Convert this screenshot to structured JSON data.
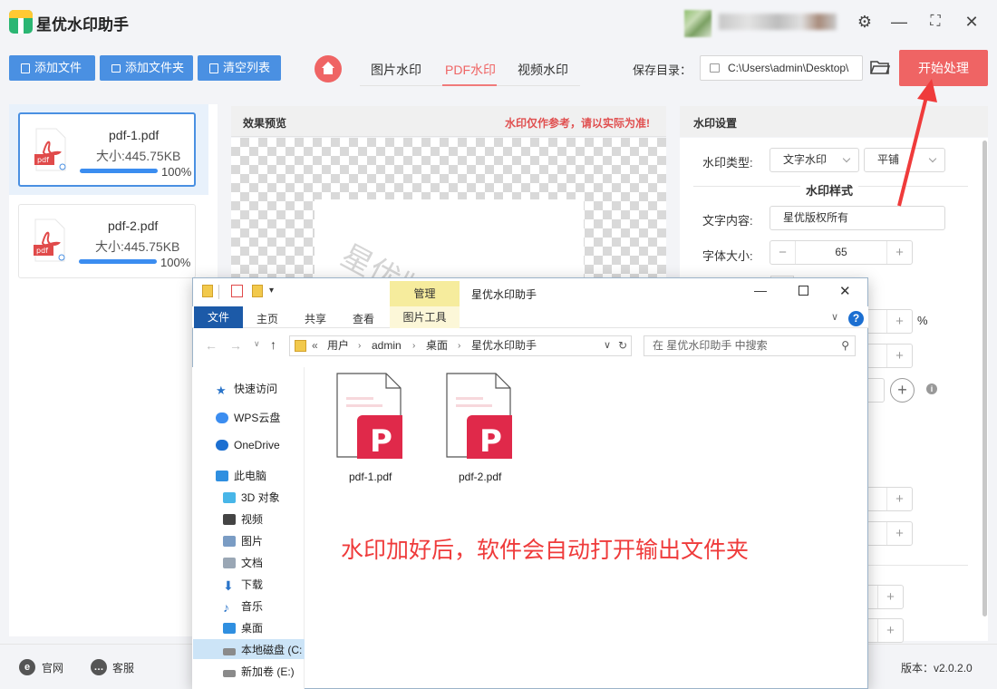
{
  "app": {
    "title": "星优水印助手",
    "version": "版本：v2.0.2.0"
  },
  "toolbar": {
    "add_file": "添加文件",
    "add_folder": "添加文件夹",
    "clear_list": "清空列表"
  },
  "tabs": [
    {
      "label": "图片水印",
      "active": false
    },
    {
      "label": "PDF水印",
      "active": true
    },
    {
      "label": "视频水印",
      "active": false
    }
  ],
  "save": {
    "label": "保存目录：",
    "path": "C:\\Users\\admin\\Desktop\\"
  },
  "start_button": "开始处理",
  "files": [
    {
      "name": "pdf-1.pdf",
      "size": "大小:445.75KB",
      "progress": "100%",
      "selected": true
    },
    {
      "name": "pdf-2.pdf",
      "size": "大小:445.75KB",
      "progress": "100%",
      "selected": false
    }
  ],
  "preview": {
    "title": "效果预览",
    "note": "水印仅作参考，请以实际为准!",
    "watermark_text": "星优版权所"
  },
  "settings": {
    "title": "水印设置",
    "type_label": "水印类型:",
    "type_value": "文字水印",
    "mode_value": "平铺",
    "style_title": "水印样式",
    "text_label": "文字内容:",
    "text_value": "星优版权所有",
    "font_size_label": "字体大小:",
    "font_size_value": "65",
    "percent": "%"
  },
  "bottom": {
    "website": "官网",
    "service": "客服"
  },
  "explorer": {
    "manage": "管理",
    "title": "星优水印助手",
    "ribbon": {
      "file": "文件",
      "home": "主页",
      "share": "共享",
      "view": "查看",
      "picture_tools": "图片工具"
    },
    "address": [
      "用户",
      "admin",
      "桌面",
      "星优水印助手"
    ],
    "search_placeholder": "在 星优水印助手 中搜索",
    "nav": [
      "快速访问",
      "WPS云盘",
      "OneDrive",
      "此电脑",
      "3D 对象",
      "视频",
      "图片",
      "文档",
      "下载",
      "音乐",
      "桌面",
      "本地磁盘 (C:",
      "新加卷 (E:)"
    ],
    "files": [
      "pdf-1.pdf",
      "pdf-2.pdf"
    ],
    "message": "水印加好后，软件会自动打开输出文件夹"
  }
}
